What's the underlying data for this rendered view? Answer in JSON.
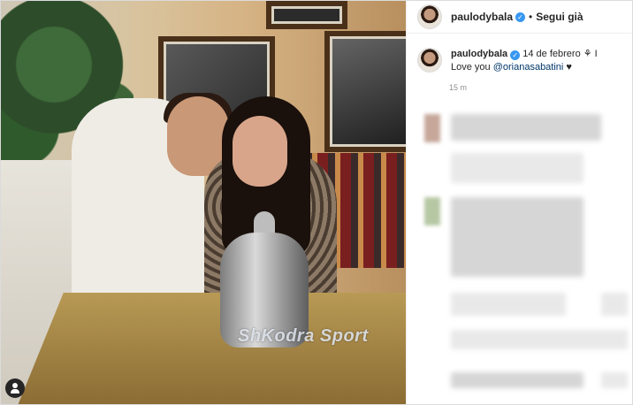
{
  "post": {
    "username": "paulodybala",
    "follow_label": "Segui già",
    "separator": "•",
    "caption": {
      "username": "paulodybala",
      "date_text": "14 de febrero",
      "trailing_symbol": "⚘ I",
      "message_prefix": "Love you ",
      "mention": "@orianasabatini",
      "message_suffix": " ♥"
    },
    "time_ago": "15 m"
  },
  "photo": {
    "watermark": "ShKodra Sport"
  },
  "icons": {
    "verified": "verified-badge-icon",
    "user_tag": "user-tag-icon"
  },
  "colors": {
    "verified": "#3897f0",
    "mention": "#00376b",
    "text": "#262626",
    "muted": "#8e8e8e"
  }
}
